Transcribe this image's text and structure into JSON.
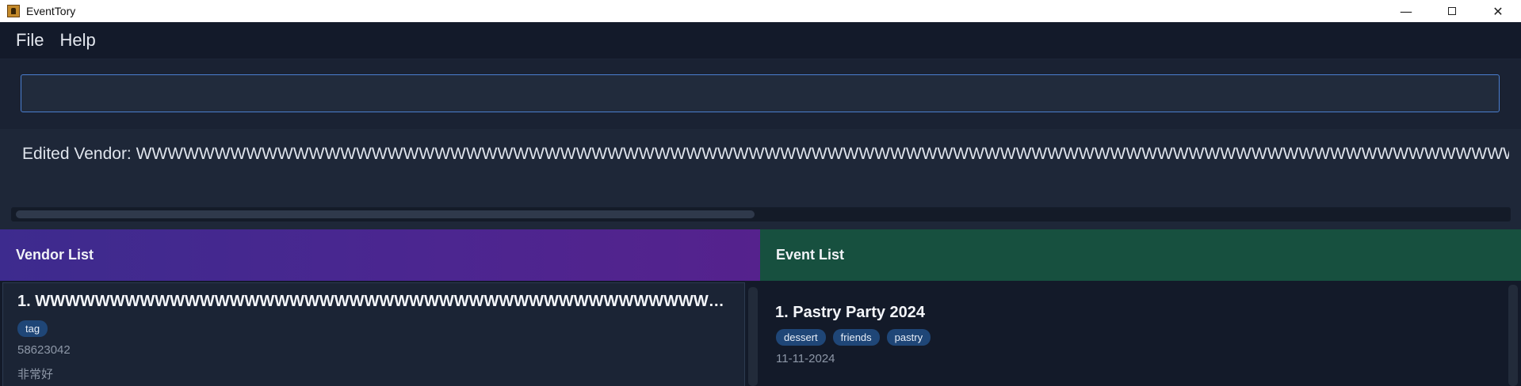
{
  "window": {
    "title": "EventTory",
    "minimize": "—",
    "close": "✕"
  },
  "menu": {
    "file": "File",
    "help": "Help"
  },
  "command": {
    "value": ""
  },
  "result": {
    "text": "Edited Vendor: WWWWWWWWWWWWWWWWWWWWWWWWWWWWWWWWWWWWWWWWWWWWWWWWWWWWWWWWWWWWWWWWWWWWWWWWWWWWWWWWWWWWWWWWWWWWWWWWWWWWWWWWWWWWWWWWWWWWWWWWWWWWWWWW"
  },
  "vendor_panel": {
    "title": "Vendor List",
    "cards": [
      {
        "title": "1. WWWWWWWWWWWWWWWWWWWWWWWWWWWWWWWWWWWWWWWWWWWWWWWWWWWWWWWWWWWWWWWWWWWWW...",
        "tags": [
          "tag"
        ],
        "phone": "58623042",
        "description": "非常好"
      }
    ]
  },
  "event_panel": {
    "title": "Event List",
    "cards": [
      {
        "title": "1. Pastry Party 2024",
        "tags": [
          "dessert",
          "friends",
          "pastry"
        ],
        "date": "11-11-2024"
      }
    ]
  },
  "colors": {
    "vendor_header": "#4b2690",
    "event_header": "#17503f",
    "tag": "#1f4677",
    "input_border": "#4a7ed0"
  }
}
